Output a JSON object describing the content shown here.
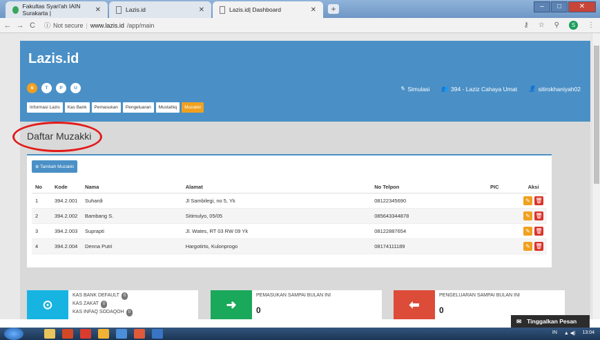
{
  "browser": {
    "tabs": [
      {
        "title": "Fakultas Syari'ah IAIN Surakarta |"
      },
      {
        "title": "Lazis.id"
      },
      {
        "title": "Lazis.id| Dashboard"
      }
    ],
    "security_label": "Not secure",
    "url_host": "www.lazis.id",
    "url_path": "/app/main",
    "profile_initial": "S"
  },
  "header": {
    "logo": "Lazis.id",
    "circles": [
      "S",
      "T",
      "P",
      "U"
    ],
    "nav_tabs": [
      "Informasi Lazis",
      "Kas Bank",
      "Pemasukan",
      "Pengeluaran",
      "Mustahiq",
      "Muzakki"
    ],
    "simulasi": "Simulasi",
    "org": "394 - Laziz Cahaya Umat",
    "user": "sitirokhaniyah02"
  },
  "page_title": "Daftar Muzakki",
  "add_button": "Tambah Muzakki",
  "table": {
    "headers": [
      "No",
      "Kode",
      "Nama",
      "Alamat",
      "No Telpon",
      "PIC",
      "Aksi"
    ],
    "rows": [
      {
        "no": "1",
        "kode": "394.2.001",
        "nama": "Suhardi",
        "alamat": "Jl Sambilegi, no 5, Yk",
        "telp": "08122345690"
      },
      {
        "no": "2",
        "kode": "394.2.002",
        "nama": "Bambang S.",
        "alamat": "Sitimulyo, 05/05",
        "telp": "085643344878"
      },
      {
        "no": "3",
        "kode": "394.2.003",
        "nama": "Suprapti",
        "alamat": "Jl. Wates, RT 03 RW 09 Yk",
        "telp": "08122887654"
      },
      {
        "no": "4",
        "kode": "394.2.004",
        "nama": "Denna Putri",
        "alamat": "Hargotirto, Kulonprogo",
        "telp": "08174111189"
      }
    ]
  },
  "summary": {
    "kas_bank_default": "KAS BANK DEFAULT",
    "kas_zakat": "KAS ZAKAT",
    "kas_infaq": "KAS INFAQ SODAQOH",
    "badge_zero": "0",
    "pemasukan_label": "PEMASUKAN SAMPAI BULAN INI",
    "pemasukan_value": "0",
    "pengeluaran_label": "PENGELUARAN SAMPAI BULAN INI",
    "pengeluaran_value": "0"
  },
  "chat_label": "Tinggalkan Pesan",
  "taskbar": {
    "lang": "IN",
    "time": "13:04"
  },
  "colors": {
    "brand": "#4a90c6",
    "accent": "#f0a020",
    "danger": "#d9342b",
    "success": "#1aa85a",
    "info": "#17b4e2",
    "pengeluaran": "#dd4b39"
  }
}
